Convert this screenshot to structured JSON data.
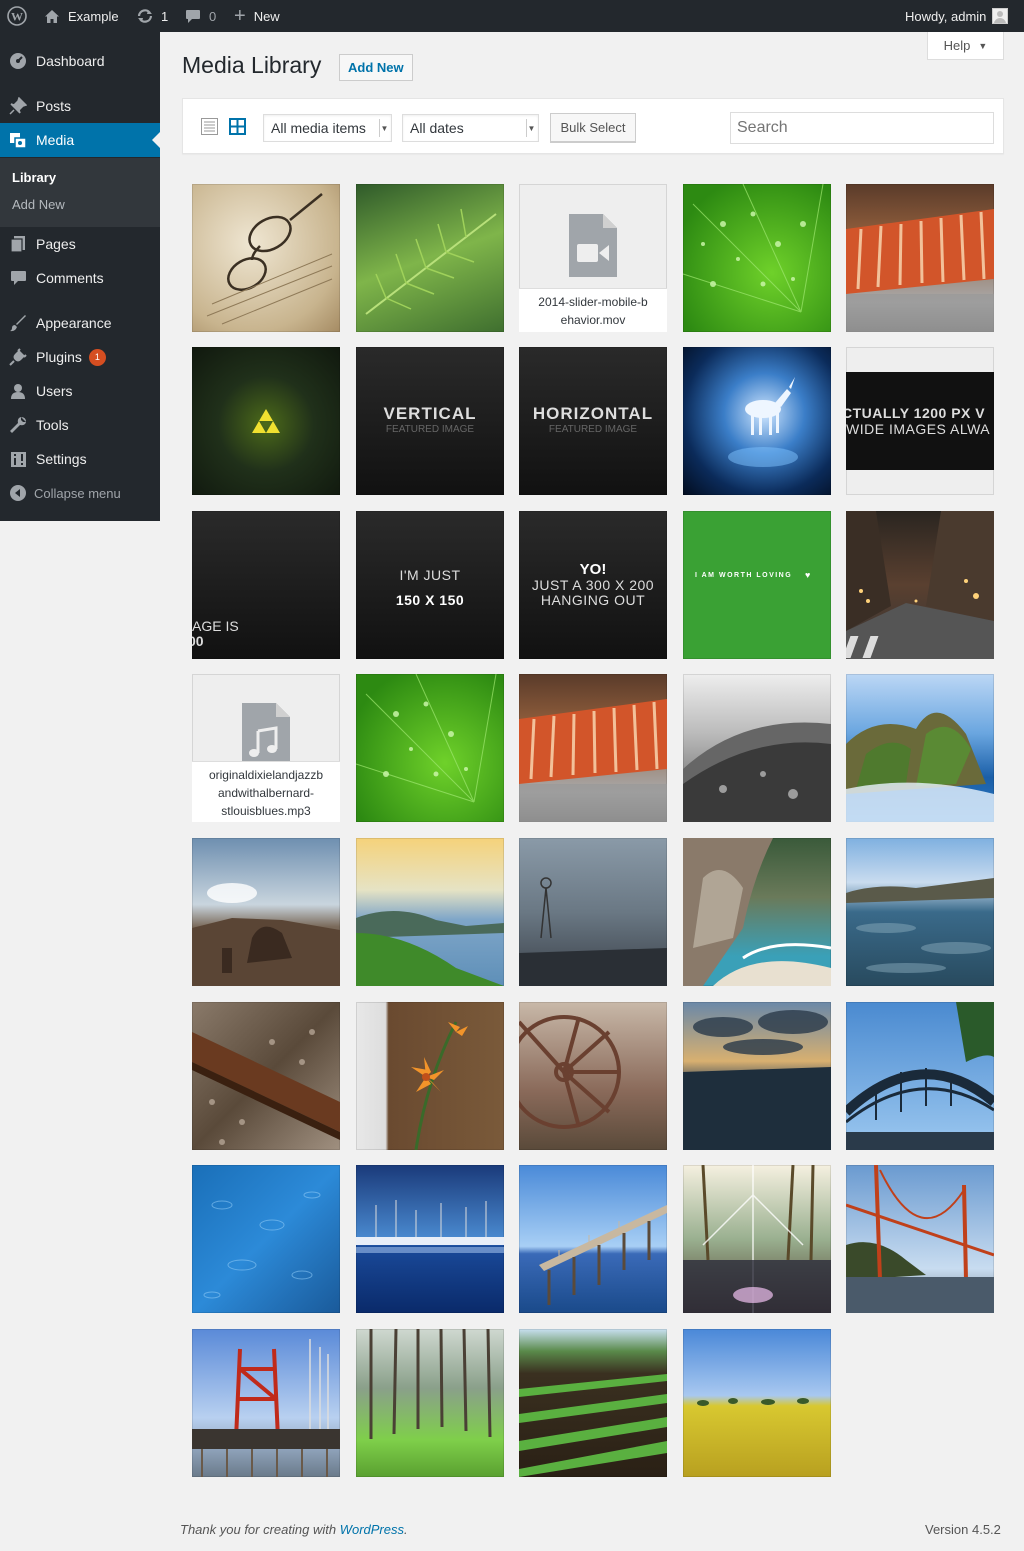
{
  "adminbar": {
    "site_name": "Example",
    "updates_count": "1",
    "comments_count": "0",
    "new_label": "New",
    "greeting": "Howdy, admin"
  },
  "sidebar": {
    "items": [
      {
        "label": "Dashboard",
        "icon": "dashboard-icon"
      },
      {
        "label": "Posts",
        "icon": "pin-icon"
      },
      {
        "label": "Media",
        "icon": "media-icon"
      },
      {
        "label": "Pages",
        "icon": "page-icon"
      },
      {
        "label": "Comments",
        "icon": "comment-icon"
      },
      {
        "label": "Appearance",
        "icon": "brush-icon"
      },
      {
        "label": "Plugins",
        "icon": "plug-icon",
        "badge": "1"
      },
      {
        "label": "Users",
        "icon": "user-icon"
      },
      {
        "label": "Tools",
        "icon": "wrench-icon"
      },
      {
        "label": "Settings",
        "icon": "settings-icon"
      }
    ],
    "submenu": [
      "Library",
      "Add New"
    ],
    "collapse_label": "Collapse menu"
  },
  "help_label": "Help",
  "page": {
    "title": "Media Library",
    "add_new": "Add New"
  },
  "toolbar": {
    "filter_type": "All media items",
    "filter_date": "All dates",
    "bulk_select": "Bulk Select",
    "search_placeholder": "Search"
  },
  "media": [
    {
      "kind": "photo",
      "desc": "glasses on letter"
    },
    {
      "kind": "photo",
      "desc": "fern leaf"
    },
    {
      "kind": "file",
      "icon": "video-icon",
      "filename": "2014-slider-mobile-behavior.mov"
    },
    {
      "kind": "photo",
      "desc": "green leaf with water drops"
    },
    {
      "kind": "photo",
      "desc": "rusted metal close-up"
    },
    {
      "kind": "photo",
      "desc": "triforce glow"
    },
    {
      "kind": "text",
      "line1": "VERTICAL",
      "line2": "FEATURED IMAGE"
    },
    {
      "kind": "text",
      "line1": "HORIZONTAL",
      "line2": "FEATURED IMAGE"
    },
    {
      "kind": "photo",
      "desc": "unicorn"
    },
    {
      "kind": "text",
      "line1": "CTUALLY 1200 PX V",
      "line2": "WIDE IMAGES ALWA"
    },
    {
      "kind": "text",
      "line1": "AGE IS",
      "line2": "00"
    },
    {
      "kind": "text",
      "line1": "I'M JUST",
      "line2": "150 X 150"
    },
    {
      "kind": "text",
      "line1": "YO!",
      "line2": "JUST A 300 X 200",
      "line3": "HANGING OUT"
    },
    {
      "kind": "text",
      "line1": "I AM WORTH LOVING"
    },
    {
      "kind": "photo",
      "desc": "city street at night"
    },
    {
      "kind": "file",
      "icon": "audio-icon",
      "filename": "originaldixielandjazzbandwithalbernard-stlouisblues.mp3",
      "caption_lines": [
        "originaldixielandjazzb",
        "andwithalbernard-",
        "stlouisblues.mp3"
      ]
    },
    {
      "kind": "photo",
      "desc": "green leaf with water drops"
    },
    {
      "kind": "photo",
      "desc": "rusted metal close-up"
    },
    {
      "kind": "photo",
      "desc": "black and white rock"
    },
    {
      "kind": "photo",
      "desc": "rocky coast"
    },
    {
      "kind": "photo",
      "desc": "rocky beach at sunset"
    },
    {
      "kind": "photo",
      "desc": "coastal hills at sunrise"
    },
    {
      "kind": "photo",
      "desc": "foggy windmill"
    },
    {
      "kind": "photo",
      "desc": "cove with waterfall"
    },
    {
      "kind": "photo",
      "desc": "rocky shoreline"
    },
    {
      "kind": "photo",
      "desc": "rusted rail track"
    },
    {
      "kind": "photo",
      "desc": "orange lily"
    },
    {
      "kind": "photo",
      "desc": "old wagon wheel"
    },
    {
      "kind": "photo",
      "desc": "clouds over sea"
    },
    {
      "kind": "photo",
      "desc": "harbour bridge"
    },
    {
      "kind": "photo",
      "desc": "rain on water"
    },
    {
      "kind": "photo",
      "desc": "marina"
    },
    {
      "kind": "photo",
      "desc": "wooden pier"
    },
    {
      "kind": "photo",
      "desc": "sun through trees"
    },
    {
      "kind": "photo",
      "desc": "golden gate bridge"
    },
    {
      "kind": "photo",
      "desc": "red tower on pier"
    },
    {
      "kind": "photo",
      "desc": "pine forest"
    },
    {
      "kind": "photo",
      "desc": "farm rows"
    },
    {
      "kind": "photo",
      "desc": "yellow field"
    }
  ],
  "footer": {
    "text": "Thank you for creating with ",
    "link": "WordPress",
    "text_end": ".",
    "version": "Version 4.5.2"
  }
}
